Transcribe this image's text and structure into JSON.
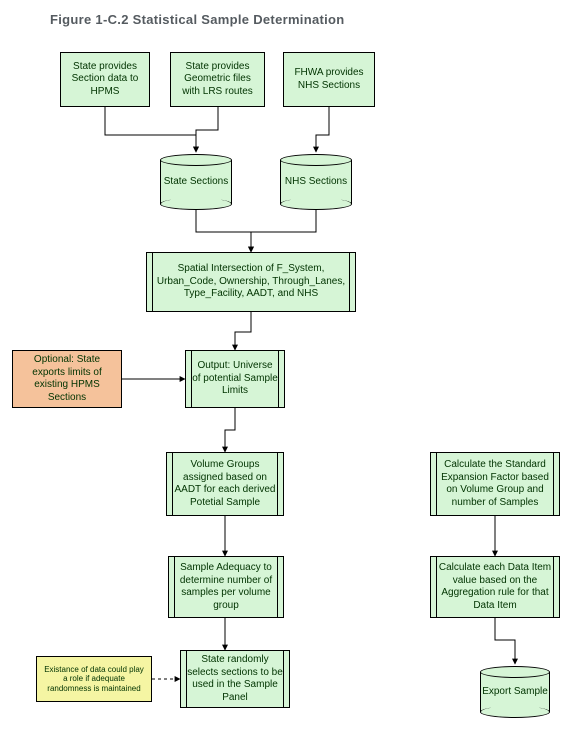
{
  "title": "Figure 1-C.2 Statistical Sample Determination",
  "boxes": {
    "state_section_hpms": "State provides Section data to HPMS",
    "state_geom_lrs": "State provides Geometric files with LRS routes",
    "fhwa_nhs": "FHWA provides NHS Sections",
    "state_sections_db": "State Sections",
    "nhs_sections_db": "NHS Sections",
    "spatial_intersection": "Spatial Intersection of  F_System, Urban_Code, Ownership, Through_Lanes, Type_Facility, AADT, and NHS",
    "optional_limits": "Optional: State exports limits of existing  HPMS Sections",
    "output_universe": "Output: Universe of potential Sample Limits",
    "volume_groups": "Volume Groups assigned based on AADT for each derived Potetial Sample",
    "calc_expansion": "Calculate the Standard Expansion Factor based on Volume Group and number of Samples",
    "sample_adequacy": "Sample Adequacy to determine number of samples per volume group",
    "calc_dataitem": "Calculate each Data Item value based on the Aggregation rule for that Data Item",
    "existence_note": "Existance of data could play a role if adequate randomness is maintained",
    "random_select": "State randomly selects sections to be used in the Sample Panel",
    "export_sample": "Export Sample"
  },
  "colors": {
    "green": "#d6f5d6",
    "orange": "#f5c29b",
    "yellow": "#f5f5a3"
  }
}
